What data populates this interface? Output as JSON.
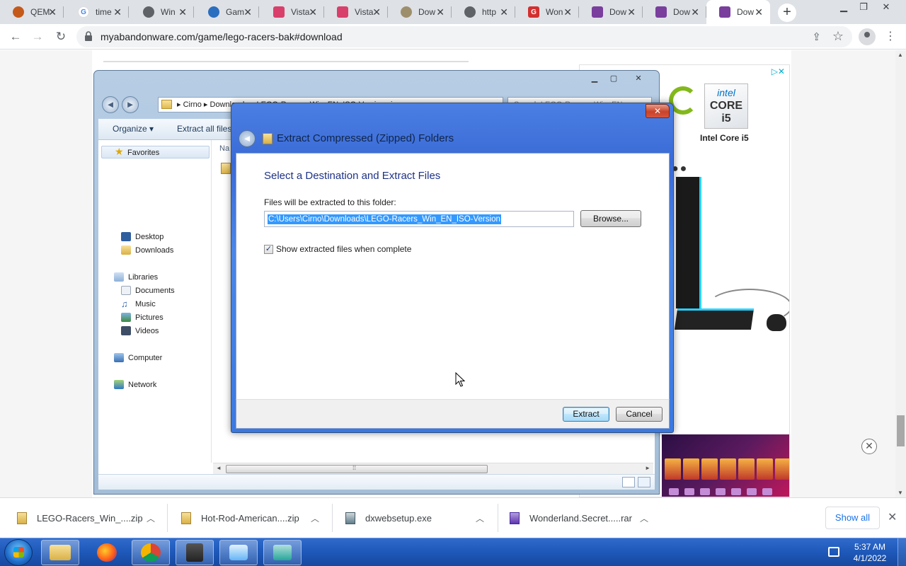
{
  "browser": {
    "tabs": [
      {
        "title": "QEM",
        "favicon": "qemu-icon",
        "color": "#c45a1a"
      },
      {
        "title": "time",
        "favicon": "google-icon",
        "color": "#4285f4"
      },
      {
        "title": "Win",
        "favicon": "globe-icon",
        "color": "#5f6368"
      },
      {
        "title": "Gam",
        "favicon": "globe-icon",
        "color": "#2a6ec0"
      },
      {
        "title": "Vista",
        "favicon": "vista-icon",
        "color": "#d93f6b"
      },
      {
        "title": "Vista",
        "favicon": "vista-icon",
        "color": "#d93f6b"
      },
      {
        "title": "Dow",
        "favicon": "download-icon",
        "color": "#9e8f6c"
      },
      {
        "title": "http",
        "favicon": "globe-icon",
        "color": "#5f6368"
      },
      {
        "title": "Won",
        "favicon": "g-icon",
        "color": "#d32f2f"
      },
      {
        "title": "Dow",
        "favicon": "abandonware-icon",
        "color": "#7a3e9d"
      },
      {
        "title": "Dow",
        "favicon": "abandonware-icon",
        "color": "#7a3e9d"
      },
      {
        "title": "Dow",
        "favicon": "abandonware-icon",
        "color": "#7a3e9d"
      }
    ],
    "new_tab": "+",
    "url": "myabandonware.com/game/lego-racers-bak#download"
  },
  "ad": {
    "adchoices": "▷✕",
    "intel_top": "intel",
    "intel_core": "CORE i5",
    "intel_label": "Intel Core i5",
    "dots": "●●",
    "close": "✕"
  },
  "explorer": {
    "address": "▸ Cirno ▸ Downloads ▸ LEGO-Racers_Win_EN_ISO-Version.zip",
    "search_placeholder": "Search LEGO-Racers_Win_EN...",
    "organize": "Organize ▾",
    "extract_all": "Extract all files",
    "column_header": "Na",
    "nav": {
      "favorites": "Favorites",
      "desktop": "Desktop",
      "downloads": "Downloads",
      "libraries": "Libraries",
      "documents": "Documents",
      "music": "Music",
      "pictures": "Pictures",
      "videos": "Videos",
      "computer": "Computer",
      "network": "Network"
    }
  },
  "dialog": {
    "title": "Extract Compressed (Zipped) Folders",
    "heading": "Select a Destination and Extract Files",
    "folder_label": "Files will be extracted to this folder:",
    "path_value": "C:\\Users\\Cirno\\Downloads\\LEGO-Racers_Win_EN_ISO-Version",
    "browse_label": "Browse...",
    "show_files_label": "Show extracted files when complete",
    "show_files_checked": true,
    "extract_label": "Extract",
    "cancel_label": "Cancel"
  },
  "downloads": {
    "items": [
      {
        "name": "LEGO-Racers_Win_....zip",
        "icon": "zip-icon"
      },
      {
        "name": "Hot-Rod-American....zip",
        "icon": "zip-icon"
      },
      {
        "name": "dxwebsetup.exe",
        "icon": "exe-icon"
      },
      {
        "name": "Wonderland.Secret.....rar",
        "icon": "rar-icon"
      }
    ],
    "show_all": "Show all"
  },
  "taskbar": {
    "time": "5:37 AM",
    "date": "4/1/2022"
  }
}
